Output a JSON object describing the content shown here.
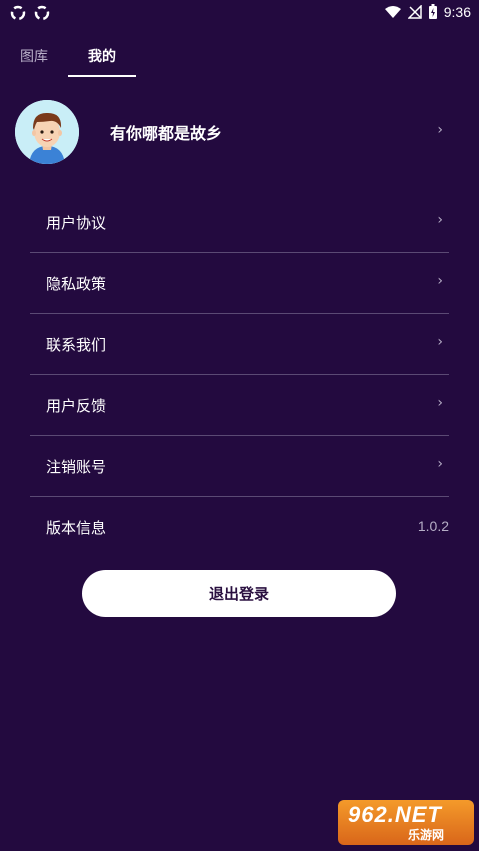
{
  "status_bar": {
    "time": "9:36",
    "left_icons": [
      "sync-icon",
      "sync-icon"
    ],
    "right_icons": [
      "wifi-icon",
      "no-signal-icon",
      "battery-charging-icon"
    ]
  },
  "tabs": [
    {
      "label": "图库",
      "selected": false
    },
    {
      "label": "我的",
      "selected": true
    }
  ],
  "profile": {
    "name": "有你哪都是故乡",
    "avatar_icon": "avatar-icon"
  },
  "menu": [
    {
      "label": "用户协议",
      "chevron": true
    },
    {
      "label": "隐私政策",
      "chevron": true
    },
    {
      "label": "联系我们",
      "chevron": true
    },
    {
      "label": "用户反馈",
      "chevron": true
    },
    {
      "label": "注销账号",
      "chevron": true
    },
    {
      "label": "版本信息",
      "value": "1.0.2"
    }
  ],
  "logout_label": "退出登录",
  "watermark": {
    "top": "962.NET",
    "bottom": "乐游网"
  },
  "colors": {
    "background": "#230a3f",
    "divider": "#5b4a74",
    "button_bg": "#ffffff",
    "button_text": "#2a1040",
    "secondary_text": "#b6aec6"
  },
  "chevron_glyph": "›"
}
